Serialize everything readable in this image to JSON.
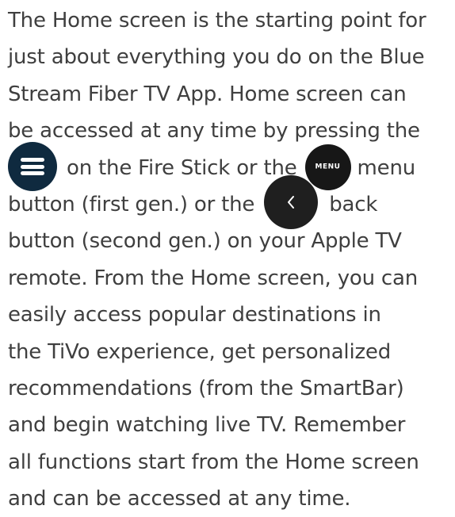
{
  "article": {
    "line1": "The Home screen is the starting point for",
    "line2": "just about everything you do on the Blue",
    "line3": "Stream Fiber TV App. Home screen can",
    "line4": "be accessed at any time by pressing the",
    "line5_a": "on the Fire Stick or the",
    "line5_b": "menu",
    "line6_a": "button (first gen.) or the",
    "line6_b": "back",
    "line7": "button (second gen.) on your Apple TV",
    "line8": "remote. From the Home screen, you can",
    "line9": "easily access popular destinations in",
    "line10": "the TiVo experience, get personalized",
    "line11": "recommendations (from the SmartBar)",
    "line12": "and begin watching live TV. Remember",
    "line13": "all functions start from the Home screen",
    "line14": "and can be accessed at any time."
  },
  "icons": {
    "hamburger": "hamburger-menu-icon",
    "menu_button": "apple-tv-menu-button-icon",
    "menu_button_text": "MENU",
    "back_button": "apple-tv-back-button-icon"
  },
  "colors": {
    "text": "#3f3f3f",
    "hamburger_bg": "#0f2a3f",
    "menu_bg": "#171717",
    "back_bg": "#1f1f1f"
  }
}
